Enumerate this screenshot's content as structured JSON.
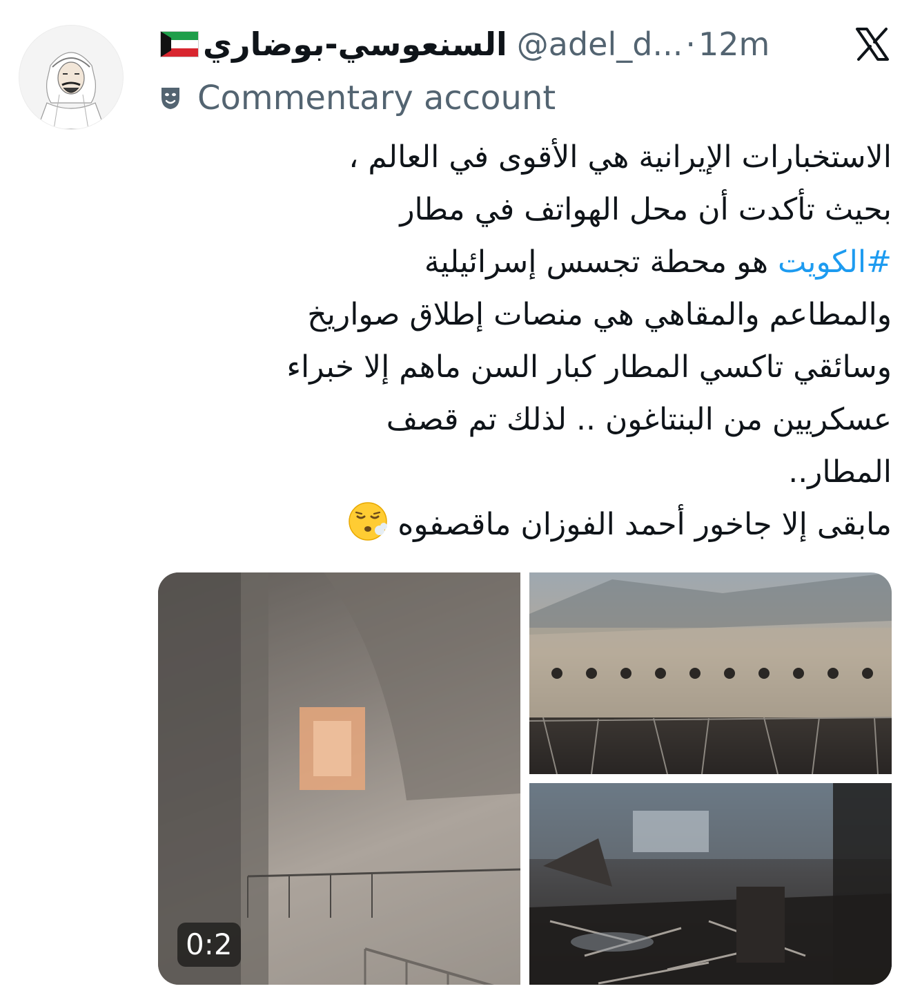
{
  "tweet": {
    "author": {
      "display_name": "السنعوسي-بوضاري",
      "handle": "@adel_d...",
      "flag_icon": "kuwait-flag-icon",
      "avatar": "sketch-portrait-avatar"
    },
    "separator": "·",
    "timestamp": "12m",
    "platform_icon": "x-logo-icon",
    "badge": {
      "icon": "theater-masks-icon",
      "label": "Commentary account"
    },
    "text": {
      "line1": "الاستخبارات الإيرانية هي الأقوى في العالم ،",
      "line2": "بحيث تأكدت أن محل الهواتف في مطار",
      "line3_hashtag": "#الكويت",
      "line3_rest": "هو محطة تجسس إسرائيلية",
      "line4": "والمطاعم والمقاهي هي منصات إطلاق صواريخ",
      "line5": "وسائقي تاكسي المطار كبار السن ماهم إلا خبراء",
      "line6": "عسكريين من البنتاغون .. لذلك تم قصف",
      "line7": "المطار..",
      "line8": "مابقى إلا جاخور أحمد الفوزان ماقصفوه",
      "emoji": "face-exhaling-emoji"
    },
    "media": {
      "video": {
        "duration": "0:2"
      }
    },
    "colors": {
      "text": "#0f1419",
      "secondary": "#536471",
      "link": "#1d9bf0",
      "background": "#ffffff"
    }
  }
}
